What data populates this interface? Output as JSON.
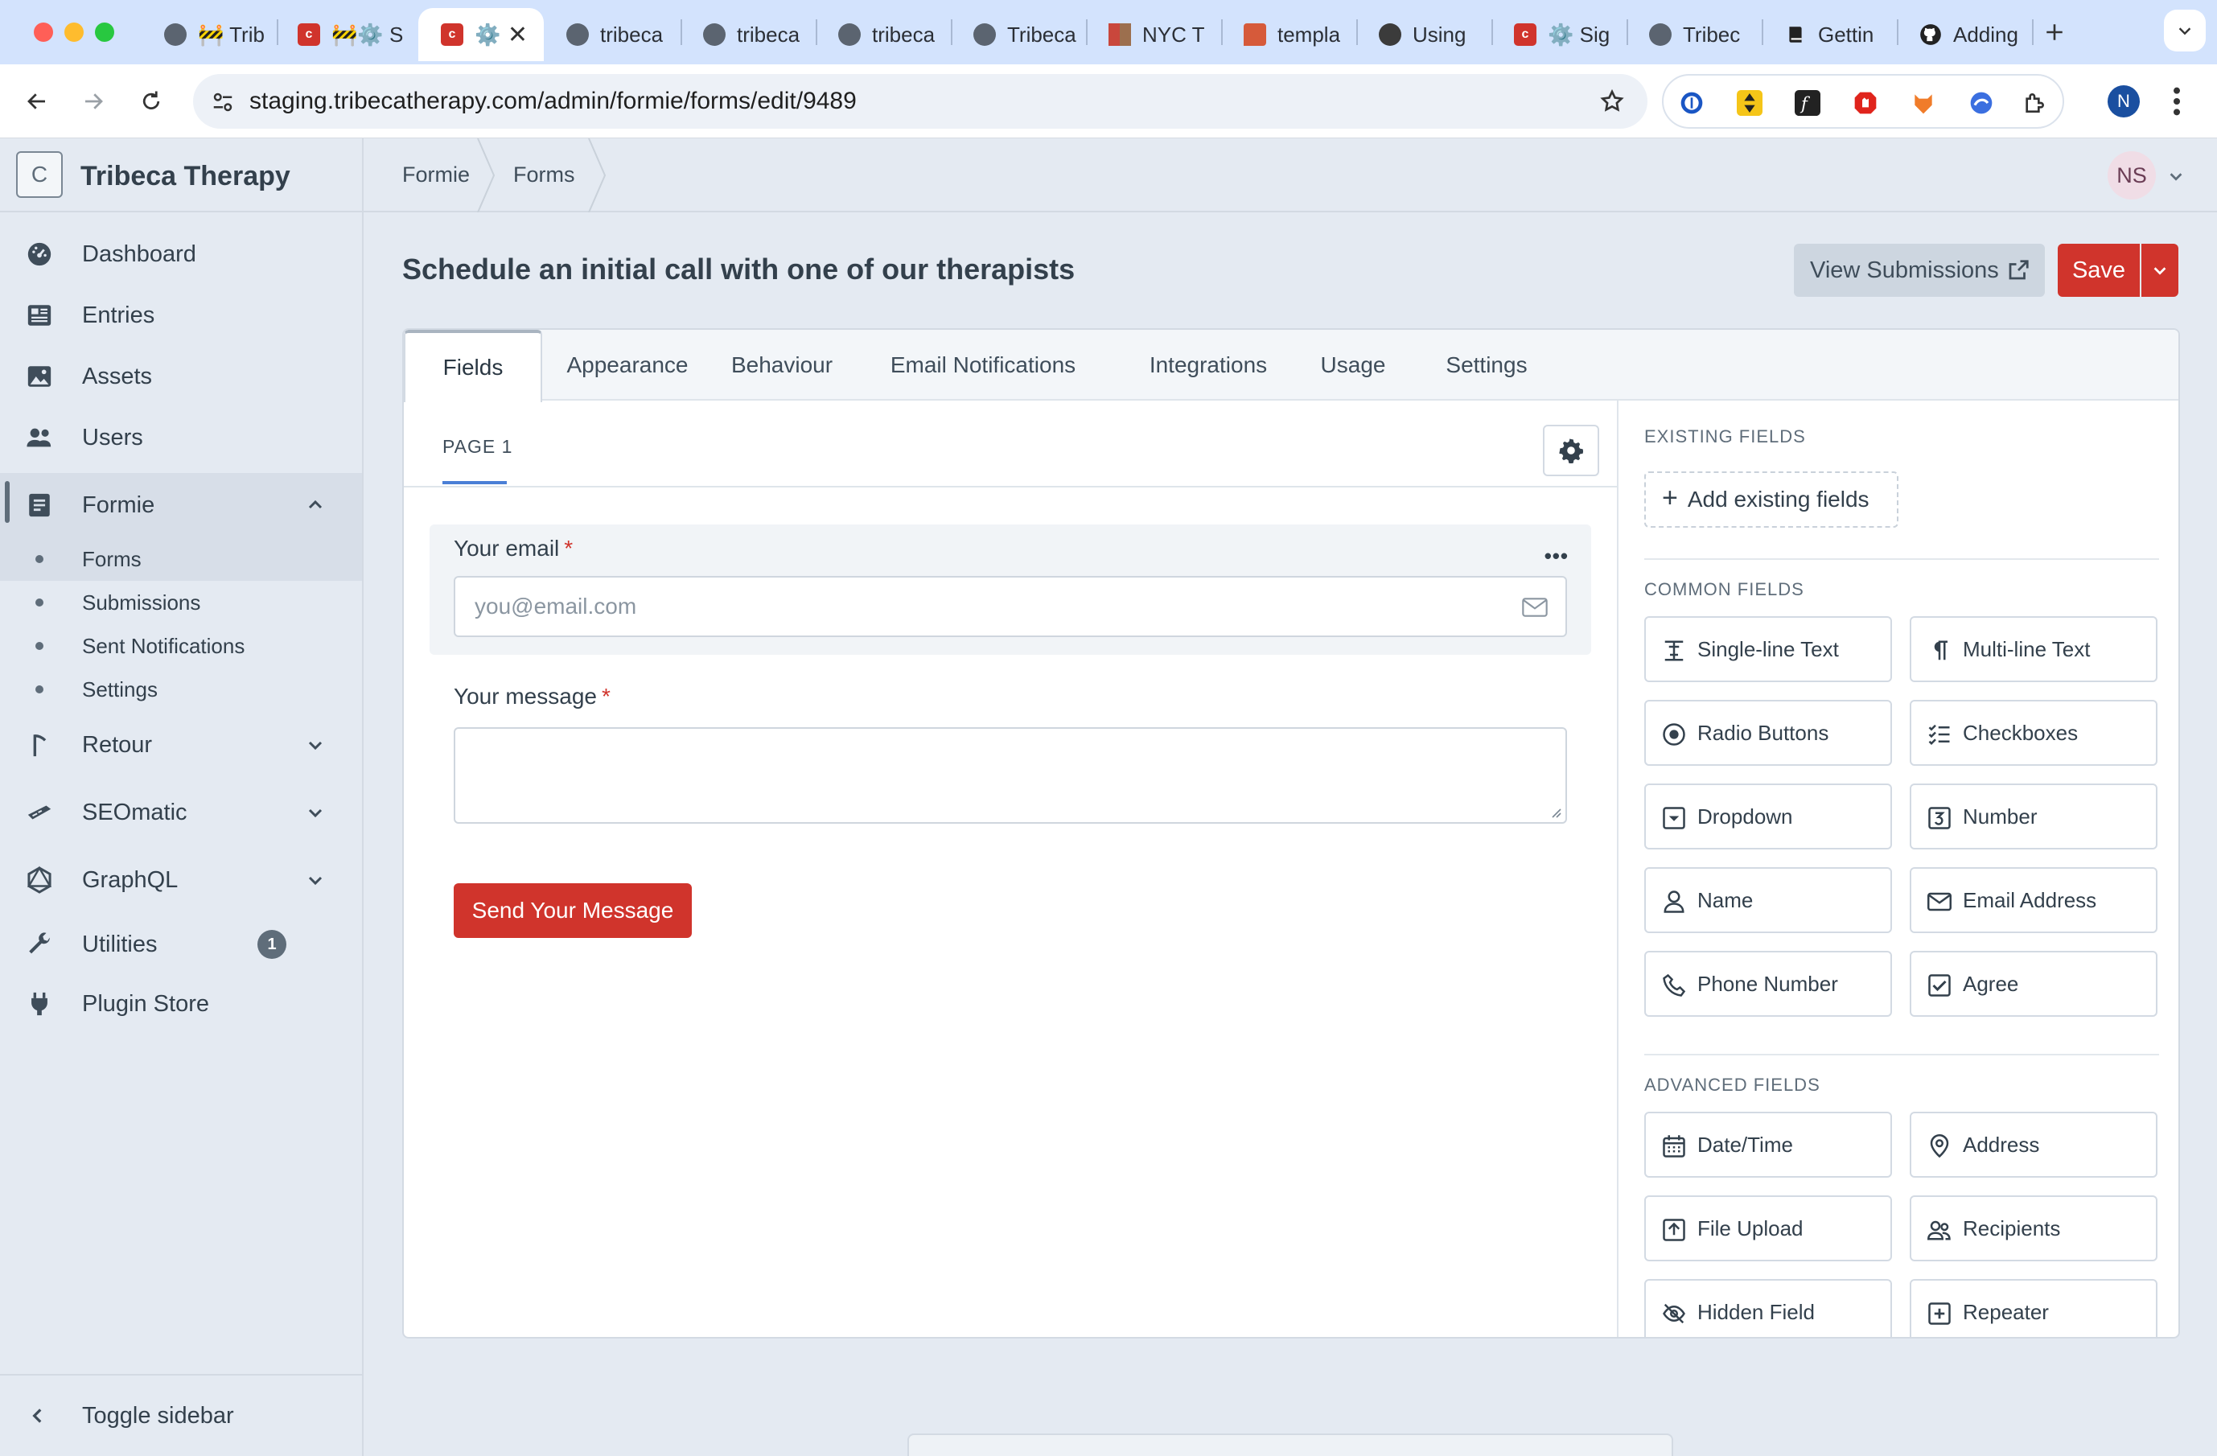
{
  "browser": {
    "tabs": [
      {
        "title": "🚧 Trib",
        "icon": "globe-icon"
      },
      {
        "title": "🚧⚙️ S",
        "icon": "craft-icon"
      },
      {
        "title": "⚙️",
        "icon": "craft-icon",
        "active": true
      },
      {
        "title": "tribeca",
        "icon": "globe-icon"
      },
      {
        "title": "tribeca",
        "icon": "globe-icon"
      },
      {
        "title": "tribeca",
        "icon": "globe-icon"
      },
      {
        "title": "Tribeca",
        "icon": "globe-icon"
      },
      {
        "title": "NYC T",
        "icon": "nyc-icon"
      },
      {
        "title": "templa",
        "icon": "doc-icon"
      },
      {
        "title": "Using",
        "icon": "dark-icon"
      },
      {
        "title": "⚙️ Sig",
        "icon": "craft-icon"
      },
      {
        "title": "Tribec",
        "icon": "globe-icon"
      },
      {
        "title": "Gettin",
        "icon": "book-icon"
      },
      {
        "title": "Adding",
        "icon": "github-icon"
      }
    ],
    "url": "staging.tribecatherapy.com/admin/formie/forms/edit/9489",
    "profile_initial": "N"
  },
  "sidebar": {
    "logo_letter": "C",
    "site_name": "Tribeca Therapy",
    "nav": [
      {
        "label": "Dashboard",
        "icon": "dashboard-icon"
      },
      {
        "label": "Entries",
        "icon": "entries-icon"
      },
      {
        "label": "Assets",
        "icon": "assets-icon"
      },
      {
        "label": "Users",
        "icon": "users-icon"
      },
      {
        "label": "Formie",
        "icon": "formie-icon"
      },
      {
        "label": "Retour",
        "icon": "retour-icon"
      },
      {
        "label": "SEOmatic",
        "icon": "seomatic-icon"
      },
      {
        "label": "GraphQL",
        "icon": "graphql-icon"
      },
      {
        "label": "Utilities",
        "icon": "utilities-icon",
        "badge": "1"
      },
      {
        "label": "Plugin Store",
        "icon": "plug-icon"
      }
    ],
    "formie_sub": [
      "Forms",
      "Submissions",
      "Sent Notifications",
      "Settings"
    ],
    "toggle_label": "Toggle sidebar"
  },
  "header": {
    "breadcrumbs": [
      "Formie",
      "Forms"
    ],
    "user_initials": "NS"
  },
  "page": {
    "title": "Schedule an initial call with one of our therapists",
    "view_submissions_label": "View Submissions",
    "save_label": "Save"
  },
  "form_tabs": [
    "Fields",
    "Appearance",
    "Behaviour",
    "Email Notifications",
    "Integrations",
    "Usage",
    "Settings"
  ],
  "builder": {
    "page_tab": "PAGE 1",
    "email_label": "Your email",
    "required_mark": "*",
    "email_placeholder": "you@email.com",
    "message_label": "Your message",
    "submit_label": "Send Your Message",
    "more_dots": "•••"
  },
  "panel": {
    "existing_heading": "EXISTING FIELDS",
    "add_existing_label": "Add existing fields",
    "common_heading": "COMMON FIELDS",
    "common_fields": [
      {
        "label": "Single-line Text",
        "icon": "single-line-text-icon"
      },
      {
        "label": "Multi-line Text",
        "icon": "pilcrow-icon"
      },
      {
        "label": "Radio Buttons",
        "icon": "radio-icon"
      },
      {
        "label": "Checkboxes",
        "icon": "checklist-icon"
      },
      {
        "label": "Dropdown",
        "icon": "dropdown-icon"
      },
      {
        "label": "Number",
        "icon": "number-icon"
      },
      {
        "label": "Name",
        "icon": "person-icon"
      },
      {
        "label": "Email Address",
        "icon": "envelope-icon"
      },
      {
        "label": "Phone Number",
        "icon": "phone-icon"
      },
      {
        "label": "Agree",
        "icon": "check-square-icon"
      }
    ],
    "advanced_heading": "ADVANCED FIELDS",
    "advanced_fields": [
      {
        "label": "Date/Time",
        "icon": "calendar-icon"
      },
      {
        "label": "Address",
        "icon": "map-pin-icon"
      },
      {
        "label": "File Upload",
        "icon": "upload-icon"
      },
      {
        "label": "Recipients",
        "icon": "recipients-icon"
      },
      {
        "label": "Hidden Field",
        "icon": "eye-slash-icon"
      },
      {
        "label": "Repeater",
        "icon": "plus-square-icon"
      }
    ]
  },
  "colors": {
    "accent_red": "#d0342c",
    "sidebar_bg": "#e4eaf2",
    "tab_underline_blue": "#4a7fd6"
  }
}
